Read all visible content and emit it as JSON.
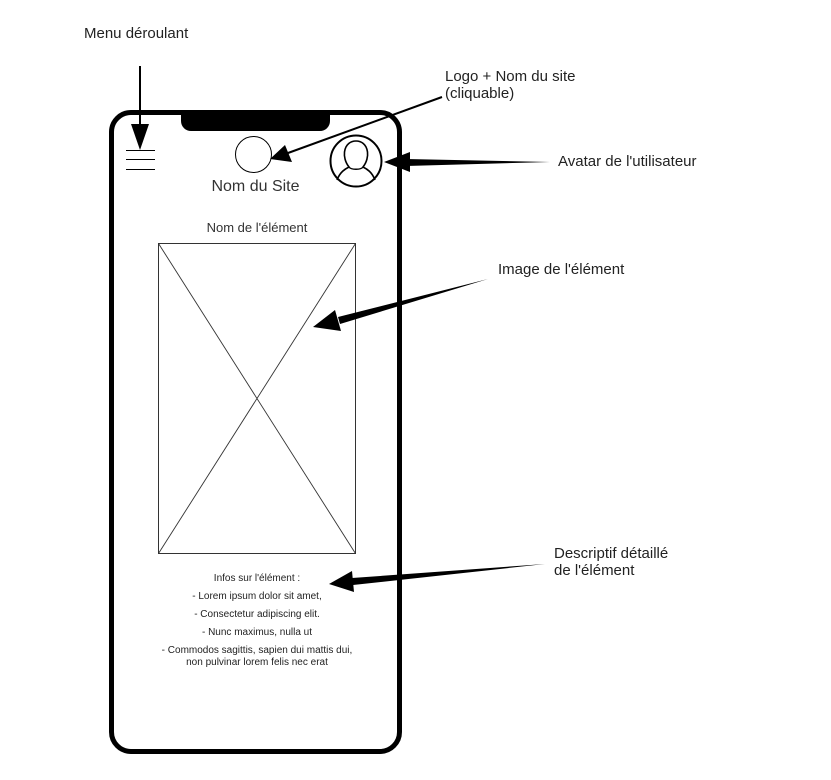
{
  "annotations": {
    "menu": "Menu déroulant",
    "logo_line1": "Logo + Nom du site",
    "logo_line2": "(cliquable)",
    "avatar": "Avatar de l'utilisateur",
    "image": "Image de l'élément",
    "description_line1": "Descriptif détaillé",
    "description_line2": "de l'élément"
  },
  "phone": {
    "site_name": "Nom du Site",
    "element_name": "Nom de l'élément",
    "details": {
      "title": "Infos sur l'élément :",
      "lines": [
        "- Lorem ipsum dolor sit amet,",
        "- Consectetur adipiscing elit.",
        "- Nunc maximus, nulla ut",
        "- Commodos sagittis, sapien dui mattis dui,",
        "non pulvinar lorem felis nec erat"
      ]
    }
  },
  "icons": {
    "menu": "hamburger-menu-icon",
    "logo": "logo-circle-icon",
    "avatar": "user-avatar-icon",
    "image": "image-placeholder-icon"
  },
  "colors": {
    "stroke": "#000000",
    "text": "#222222",
    "background": "#ffffff"
  }
}
